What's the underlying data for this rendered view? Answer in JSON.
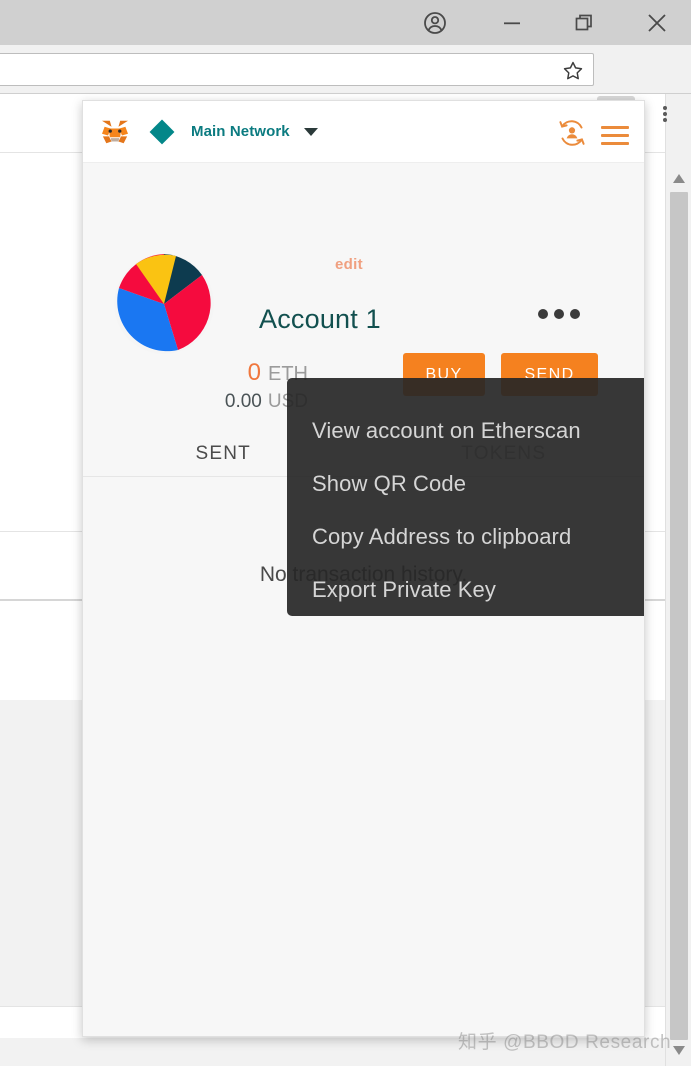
{
  "browser": {
    "titlebar": {
      "profile_icon": "profile-avatar-icon",
      "minimize_label": "minimize-icon",
      "restore_label": "restore-icon",
      "close_label": "close-icon"
    },
    "toolbar": {
      "address_value": "",
      "address_placeholder": "",
      "bookmark_icon": "star-icon",
      "extension_icon": "metamask-fox-icon",
      "menu_icon": "chrome-menu-icon"
    },
    "scrollbar": {
      "up_arrow": "scroll-up-icon",
      "down_arrow": "scroll-down-icon"
    }
  },
  "popup": {
    "header": {
      "logo": "metamask-fox-logo",
      "network_icon": "network-diamond-icon",
      "network_name": "Main Network",
      "network_caret": "chevron-down-icon",
      "account_switch_icon": "account-switch-icon",
      "menu_icon": "hamburger-menu-icon"
    },
    "account": {
      "identicon": "account-identicon",
      "edit_label": "edit",
      "name": "Account 1",
      "options_icon": "ellipsis-icon",
      "balance_eth": "0",
      "balance_eth_unit": "ETH",
      "balance_usd": "0.00",
      "balance_usd_unit": "USD",
      "buy_label": "BUY",
      "send_label": "SEND"
    },
    "tabs": [
      {
        "label": "SENT",
        "active": true
      },
      {
        "label": "TOKENS",
        "active": false
      }
    ],
    "body": {
      "empty_message": "No transaction history."
    },
    "account_menu": [
      "View account on Etherscan",
      "Show QR Code",
      "Copy Address to clipboard",
      "Export Private Key"
    ]
  },
  "watermark": "知乎 @BBOD Research",
  "colors": {
    "accent_orange": "#f5811f",
    "teal": "#0b7b80",
    "menu_bg": "#262626",
    "popup_bg": "#f7f7f7"
  }
}
